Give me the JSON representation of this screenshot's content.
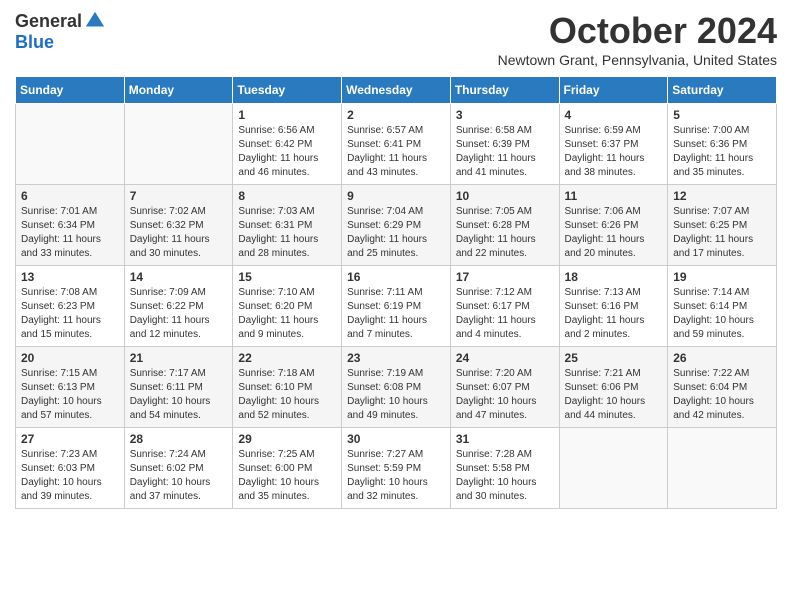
{
  "header": {
    "logo_general": "General",
    "logo_blue": "Blue",
    "month_title": "October 2024",
    "location": "Newtown Grant, Pennsylvania, United States"
  },
  "weekdays": [
    "Sunday",
    "Monday",
    "Tuesday",
    "Wednesday",
    "Thursday",
    "Friday",
    "Saturday"
  ],
  "weeks": [
    [
      null,
      null,
      {
        "day": 1,
        "sunrise": "6:56 AM",
        "sunset": "6:42 PM",
        "daylight": "11 hours and 46 minutes."
      },
      {
        "day": 2,
        "sunrise": "6:57 AM",
        "sunset": "6:41 PM",
        "daylight": "11 hours and 43 minutes."
      },
      {
        "day": 3,
        "sunrise": "6:58 AM",
        "sunset": "6:39 PM",
        "daylight": "11 hours and 41 minutes."
      },
      {
        "day": 4,
        "sunrise": "6:59 AM",
        "sunset": "6:37 PM",
        "daylight": "11 hours and 38 minutes."
      },
      {
        "day": 5,
        "sunrise": "7:00 AM",
        "sunset": "6:36 PM",
        "daylight": "11 hours and 35 minutes."
      }
    ],
    [
      {
        "day": 6,
        "sunrise": "7:01 AM",
        "sunset": "6:34 PM",
        "daylight": "11 hours and 33 minutes."
      },
      {
        "day": 7,
        "sunrise": "7:02 AM",
        "sunset": "6:32 PM",
        "daylight": "11 hours and 30 minutes."
      },
      {
        "day": 8,
        "sunrise": "7:03 AM",
        "sunset": "6:31 PM",
        "daylight": "11 hours and 28 minutes."
      },
      {
        "day": 9,
        "sunrise": "7:04 AM",
        "sunset": "6:29 PM",
        "daylight": "11 hours and 25 minutes."
      },
      {
        "day": 10,
        "sunrise": "7:05 AM",
        "sunset": "6:28 PM",
        "daylight": "11 hours and 22 minutes."
      },
      {
        "day": 11,
        "sunrise": "7:06 AM",
        "sunset": "6:26 PM",
        "daylight": "11 hours and 20 minutes."
      },
      {
        "day": 12,
        "sunrise": "7:07 AM",
        "sunset": "6:25 PM",
        "daylight": "11 hours and 17 minutes."
      }
    ],
    [
      {
        "day": 13,
        "sunrise": "7:08 AM",
        "sunset": "6:23 PM",
        "daylight": "11 hours and 15 minutes."
      },
      {
        "day": 14,
        "sunrise": "7:09 AM",
        "sunset": "6:22 PM",
        "daylight": "11 hours and 12 minutes."
      },
      {
        "day": 15,
        "sunrise": "7:10 AM",
        "sunset": "6:20 PM",
        "daylight": "11 hours and 9 minutes."
      },
      {
        "day": 16,
        "sunrise": "7:11 AM",
        "sunset": "6:19 PM",
        "daylight": "11 hours and 7 minutes."
      },
      {
        "day": 17,
        "sunrise": "7:12 AM",
        "sunset": "6:17 PM",
        "daylight": "11 hours and 4 minutes."
      },
      {
        "day": 18,
        "sunrise": "7:13 AM",
        "sunset": "6:16 PM",
        "daylight": "11 hours and 2 minutes."
      },
      {
        "day": 19,
        "sunrise": "7:14 AM",
        "sunset": "6:14 PM",
        "daylight": "10 hours and 59 minutes."
      }
    ],
    [
      {
        "day": 20,
        "sunrise": "7:15 AM",
        "sunset": "6:13 PM",
        "daylight": "10 hours and 57 minutes."
      },
      {
        "day": 21,
        "sunrise": "7:17 AM",
        "sunset": "6:11 PM",
        "daylight": "10 hours and 54 minutes."
      },
      {
        "day": 22,
        "sunrise": "7:18 AM",
        "sunset": "6:10 PM",
        "daylight": "10 hours and 52 minutes."
      },
      {
        "day": 23,
        "sunrise": "7:19 AM",
        "sunset": "6:08 PM",
        "daylight": "10 hours and 49 minutes."
      },
      {
        "day": 24,
        "sunrise": "7:20 AM",
        "sunset": "6:07 PM",
        "daylight": "10 hours and 47 minutes."
      },
      {
        "day": 25,
        "sunrise": "7:21 AM",
        "sunset": "6:06 PM",
        "daylight": "10 hours and 44 minutes."
      },
      {
        "day": 26,
        "sunrise": "7:22 AM",
        "sunset": "6:04 PM",
        "daylight": "10 hours and 42 minutes."
      }
    ],
    [
      {
        "day": 27,
        "sunrise": "7:23 AM",
        "sunset": "6:03 PM",
        "daylight": "10 hours and 39 minutes."
      },
      {
        "day": 28,
        "sunrise": "7:24 AM",
        "sunset": "6:02 PM",
        "daylight": "10 hours and 37 minutes."
      },
      {
        "day": 29,
        "sunrise": "7:25 AM",
        "sunset": "6:00 PM",
        "daylight": "10 hours and 35 minutes."
      },
      {
        "day": 30,
        "sunrise": "7:27 AM",
        "sunset": "5:59 PM",
        "daylight": "10 hours and 32 minutes."
      },
      {
        "day": 31,
        "sunrise": "7:28 AM",
        "sunset": "5:58 PM",
        "daylight": "10 hours and 30 minutes."
      },
      null,
      null
    ]
  ]
}
